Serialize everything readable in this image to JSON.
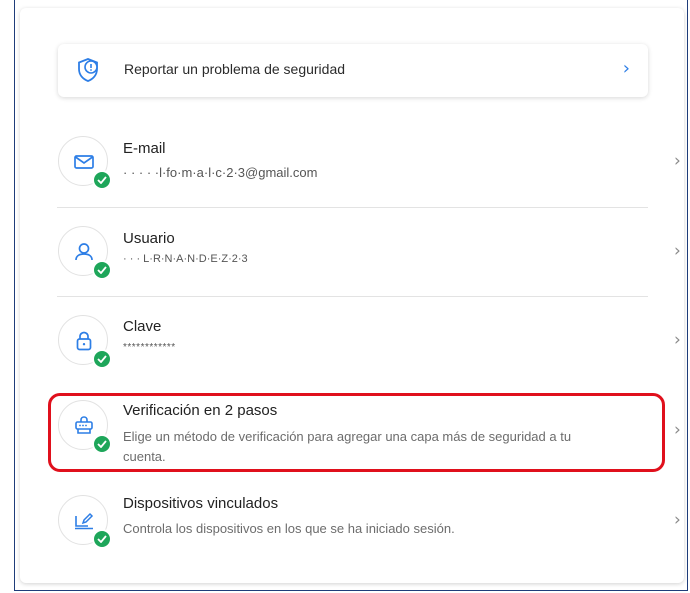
{
  "report": {
    "label": "Reportar un problema de seguridad",
    "chevron": "›"
  },
  "items": [
    {
      "icon": "envelope-icon",
      "title": "E-mail",
      "subtitle": "· · · · ·l·fo·m·a·l·c·2·3@gmail.com",
      "chevron": "›",
      "status": "verified"
    },
    {
      "icon": "user-icon",
      "title": "Usuario",
      "subtitle": "· · · L·R·N·A·N·D·E·Z·2·3",
      "chevron": "›",
      "status": "verified"
    },
    {
      "icon": "lock-icon",
      "title": "Clave",
      "subtitle": "************",
      "chevron": "›",
      "status": "verified"
    },
    {
      "icon": "two-step-device-icon",
      "title": "Verificación en 2 pasos",
      "subtitle": "Elige un método de verificación para agregar una capa más de seguridad a tu cuenta.",
      "chevron": "›",
      "status": "verified",
      "highlighted": true
    },
    {
      "icon": "linked-devices-icon",
      "title": "Dispositivos vinculados",
      "subtitle": "Controla los dispositivos en los que se ha iniciado sesión.",
      "chevron": "›",
      "status": "verified"
    }
  ],
  "colors": {
    "accent": "#2d7ee6",
    "verified": "#1ea65a",
    "highlight_border": "#e0101c"
  }
}
